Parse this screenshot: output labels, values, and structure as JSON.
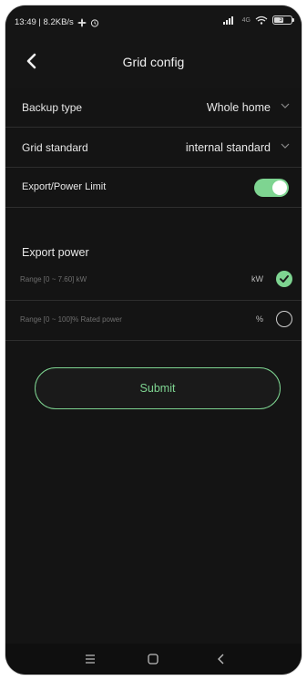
{
  "statusbar": {
    "time_speed": "13:49 | 8.2KB/s",
    "network": "4G",
    "battery": "37"
  },
  "header": {
    "title": "Grid config"
  },
  "settings": {
    "backup_type": {
      "label": "Backup type",
      "value": "Whole home"
    },
    "grid_standard": {
      "label": "Grid standard",
      "value": "internal standard"
    },
    "export_limit": {
      "label": "Export/Power Limit",
      "enabled": true
    }
  },
  "export_power": {
    "title": "Export power",
    "options": [
      {
        "range": "Range [0 ~ 7.60] kW",
        "unit": "kW",
        "selected": true
      },
      {
        "range": "Range [0 ~ 100]% Rated power",
        "unit": "%",
        "selected": false
      }
    ]
  },
  "submit_label": "Submit",
  "colors": {
    "accent": "#7ed491",
    "background": "#141414"
  },
  "icons": [
    "back-arrow-icon",
    "chevron-down-icon",
    "check-icon",
    "menu-icon",
    "home-icon",
    "back-nav-icon"
  ]
}
